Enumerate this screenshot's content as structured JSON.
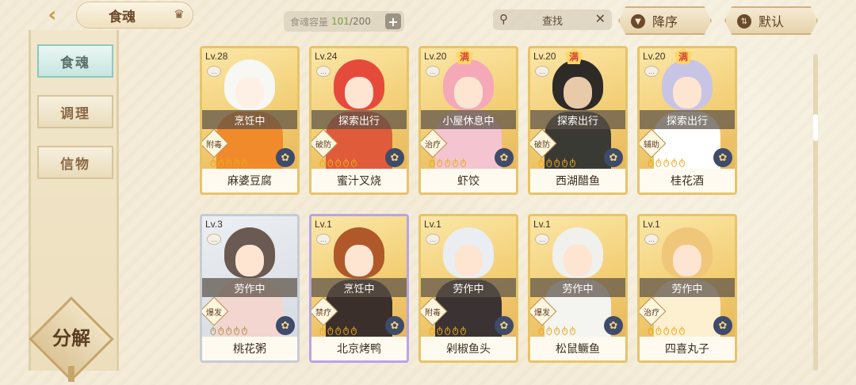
{
  "header": {
    "back_icon": "chevron-left-icon",
    "title": "食魂",
    "title_icon": "crown-icon",
    "capacity": {
      "label": "食魂容量",
      "current": "101",
      "separator": "/",
      "max": "200"
    },
    "search": {
      "placeholder": "查找"
    },
    "sort_order": "降序",
    "sort_mode": "默认"
  },
  "sidebar": {
    "items": [
      {
        "label": "食魂",
        "active": true
      },
      {
        "label": "调理",
        "active": false
      },
      {
        "label": "信物",
        "active": false
      }
    ],
    "decompose_label": "分解"
  },
  "cards": [
    {
      "level": "Lv.28",
      "status": "烹饪中",
      "tag": "附毒",
      "name": "麻婆豆腐",
      "full": "",
      "frame": "gold"
    },
    {
      "level": "Lv.24",
      "status": "探索出行",
      "tag": "破防",
      "name": "蜜汁叉烧",
      "full": "",
      "frame": "gold"
    },
    {
      "level": "Lv.20",
      "status": "小屋休息中",
      "tag": "治疗",
      "name": "虾饺",
      "full": "满",
      "frame": "gold"
    },
    {
      "level": "Lv.20",
      "status": "探索出行",
      "tag": "破防",
      "name": "西湖醋鱼",
      "full": "满",
      "frame": "gold"
    },
    {
      "level": "Lv.20",
      "status": "探索出行",
      "tag": "辅助",
      "name": "桂花酒",
      "full": "满",
      "frame": "gold"
    },
    {
      "level": "Lv.3",
      "status": "劳作中",
      "tag": "爆发",
      "name": "桃花粥",
      "full": "",
      "frame": "grey"
    },
    {
      "level": "Lv.1",
      "status": "烹饪中",
      "tag": "禁疗",
      "name": "北京烤鸭",
      "full": "",
      "frame": "rainbow"
    },
    {
      "level": "Lv.1",
      "status": "劳作中",
      "tag": "附毒",
      "name": "剁椒鱼头",
      "full": "",
      "frame": "gold"
    },
    {
      "level": "Lv.1",
      "status": "劳作中",
      "tag": "爆发",
      "name": "松鼠鳜鱼",
      "full": "",
      "frame": "gold"
    },
    {
      "level": "Lv.1",
      "status": "劳作中",
      "tag": "治疗",
      "name": "四喜丸子",
      "full": "",
      "frame": "gold"
    }
  ],
  "colors": {
    "background": "#f4ecd8",
    "gold_frame": "#e7c46a",
    "capacity_current": "#77a13a",
    "active_tab": "#c7e6e0"
  }
}
